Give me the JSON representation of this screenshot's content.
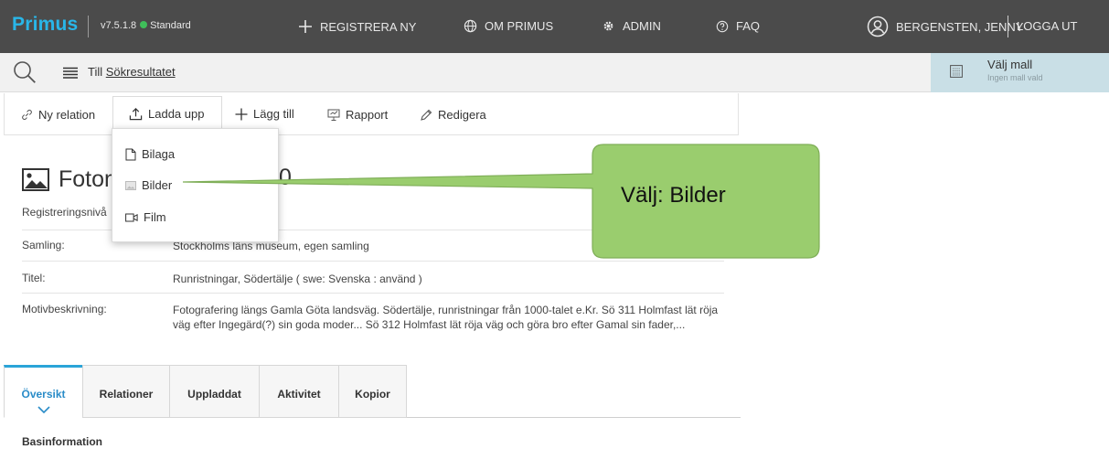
{
  "topbar": {
    "logo": "Primus",
    "version": "v7.5.1.8",
    "edition": "Standard",
    "nav": [
      "REGISTRERA NY",
      "OM PRIMUS",
      "ADMIN",
      "FAQ"
    ],
    "user": "BERGENSTEN, JENNY",
    "logout": "LOGGA UT"
  },
  "subbar": {
    "back_prefix": "Till ",
    "back_link": "Sökresultatet",
    "template_title": "Välj mall",
    "template_sub": "Ingen mall vald"
  },
  "toolbar": {
    "items": [
      "Ny relation",
      "Ladda upp",
      "Lägg till",
      "Rapport",
      "Redigera"
    ]
  },
  "dropdown": {
    "items": [
      "Bilaga",
      "Bilder",
      "Film"
    ]
  },
  "record": {
    "title_start": "Fotom",
    "title_end": "0",
    "rows": [
      {
        "label": "Registreringsnivå",
        "value": ""
      },
      {
        "label": "Samling:",
        "value": "Stockholms läns museum, egen samling"
      },
      {
        "label": "Titel:",
        "value": "Runristningar, Södertälje  ( swe: Svenska :   använd )"
      },
      {
        "label": "Motivbeskrivning:",
        "value": "Fotografering längs Gamla Göta landsväg. Södertälje, runristningar från 1000-talet e.Kr. Sö 311 Holmfast lät röja väg efter Ingegärd(?) sin goda moder... Sö 312 Holmfast lät röja väg och göra bro efter Gamal sin fader,..."
      }
    ]
  },
  "callout": {
    "text": "Välj: Bilder",
    "fill": "#9acd6e",
    "stroke": "#7fae58"
  },
  "tabs": [
    "Översikt",
    "Relationer",
    "Uppladdat",
    "Aktivitet",
    "Kopior"
  ],
  "section_title": "Basinformation",
  "colors": {
    "topbar": "#4b4b4b",
    "accent": "#29b6e8",
    "status_green": "#3fbf5a",
    "template_panel": "#c9dfe6"
  }
}
